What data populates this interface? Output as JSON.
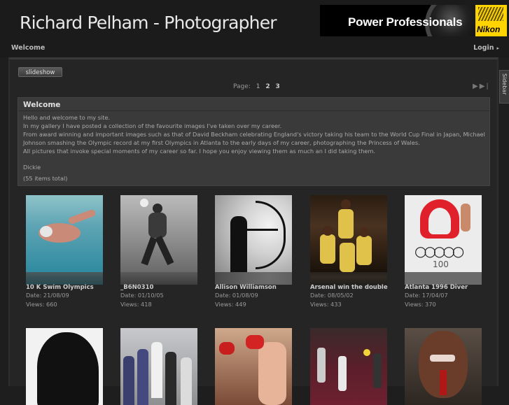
{
  "header": {
    "site_title": "Richard Pelham - Photographer",
    "ad_text": "Power Professionals",
    "ad_brand": "Nikon"
  },
  "nav": {
    "welcome": "Welcome",
    "login": "Login",
    "login_arrow": "▸"
  },
  "toolbar": {
    "slideshow": "slideshow",
    "page_label": "Page:",
    "pages": [
      "1",
      "2",
      "3"
    ],
    "next": "▶",
    "last": "▶|"
  },
  "sidebar": {
    "label": "Sidebar"
  },
  "welcome": {
    "heading": "Welcome",
    "lines": [
      "Hello and welcome to my site.",
      "In my gallery I have posted a collection of the favourite images I've taken over my career.",
      "From award winning and important images such as that of David Beckham celebrating England's victory taking his team to the World Cup Final in Japan, Michael Johnson smashing the Olympic record at my first Olympics in Atlanta to the early days of my career, photographing the Princess of Wales.",
      "All pictures that invoke special moments of my career so far. I hope you enjoy viewing them as much an I did taking them.",
      "",
      "Dickie",
      "",
      "(55 items total)"
    ]
  },
  "gallery": {
    "items": [
      {
        "title": "10 K Swim Olympics",
        "date": "Date: 21/08/09",
        "views": "Views: 660"
      },
      {
        "title": "_B6N0310",
        "date": "Date: 01/10/05",
        "views": "Views: 418"
      },
      {
        "title": "Allison Williamson",
        "date": "Date: 01/08/09",
        "views": "Views: 449"
      },
      {
        "title": "Arsenal win the double",
        "date": "Date: 08/05/02",
        "views": "Views: 433"
      },
      {
        "title": "Atlanta 1996 Diver",
        "date": "Date: 17/04/07",
        "views": "Views: 370"
      }
    ]
  },
  "colors": {
    "background": "#1e1e1e",
    "panel": "#252525",
    "welcome_box": "#3a3a3a",
    "ad_yellow": "#ffd400"
  }
}
